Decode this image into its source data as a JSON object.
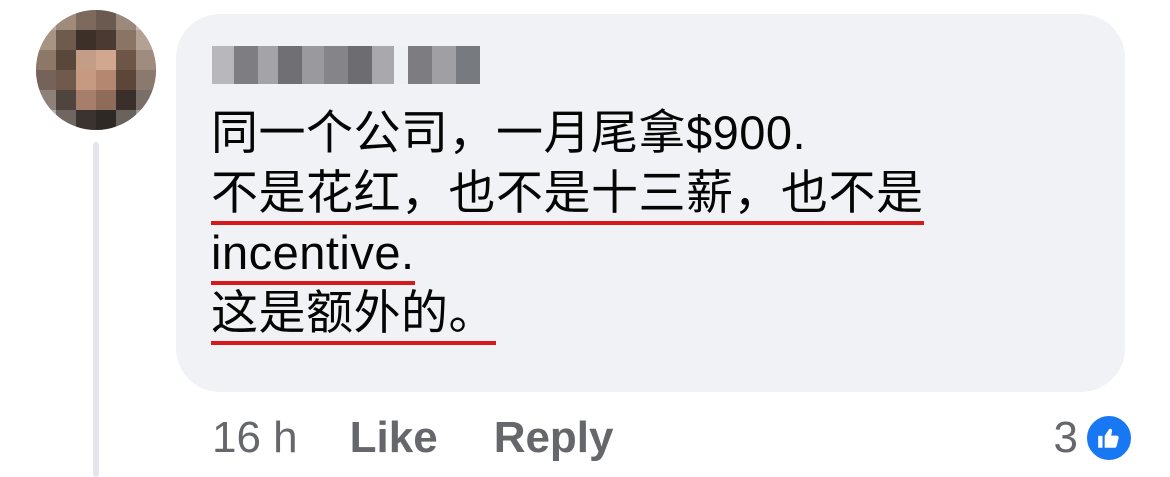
{
  "comment": {
    "lines": [
      "同一个公司，一月尾拿$900.",
      "不是花红，也不是十三薪，也不是",
      "incentive.",
      "这是额外的。"
    ]
  },
  "actions": {
    "time": "16 h",
    "like_label": "Like",
    "reply_label": "Reply"
  },
  "reactions": {
    "count": "3",
    "icon": "like-icon"
  },
  "colors": {
    "bubble": "#f0f2f5",
    "underline": "#d7191c",
    "like_blue": "#1877f2",
    "meta_gray": "#65676b"
  }
}
